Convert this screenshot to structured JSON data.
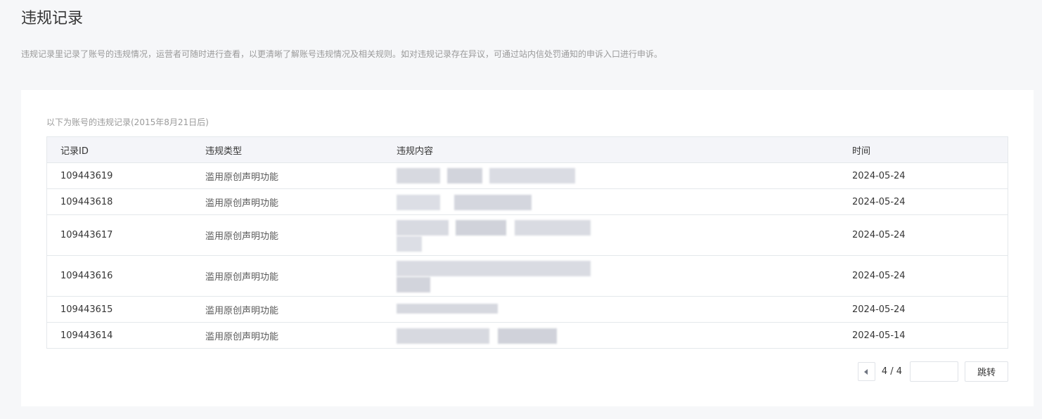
{
  "page": {
    "title": "违规记录",
    "description": "违规记录里记录了账号的违规情况，运营者可随时进行查看，以更清晰了解账号违规情况及相关规则。如对违规记录存在异议，可通过站内信处罚通知的申诉入口进行申诉。"
  },
  "records": {
    "caption": "以下为账号的违规记录(2015年8月21日后)",
    "headers": {
      "id": "记录ID",
      "type": "违规类型",
      "content": "违规内容",
      "time": "时间"
    },
    "rows": [
      {
        "id": "109443619",
        "type": "滥用原创声明功能",
        "time": "2024-05-24"
      },
      {
        "id": "109443618",
        "type": "滥用原创声明功能",
        "time": "2024-05-24"
      },
      {
        "id": "109443617",
        "type": "滥用原创声明功能",
        "time": "2024-05-24"
      },
      {
        "id": "109443616",
        "type": "滥用原创声明功能",
        "time": "2024-05-24"
      },
      {
        "id": "109443615",
        "type": "滥用原创声明功能",
        "time": "2024-05-24"
      },
      {
        "id": "109443614",
        "type": "滥用原创声明功能",
        "time": "2024-05-14"
      }
    ]
  },
  "pagination": {
    "current_label": "4 / 4",
    "jump_input_value": "",
    "jump_label": "跳转"
  },
  "colors": {
    "page_bg": "#f6f7f9",
    "header_bg": "#f4f5f9",
    "border": "#e4e8eb",
    "muted_text": "#9a9a9a"
  }
}
